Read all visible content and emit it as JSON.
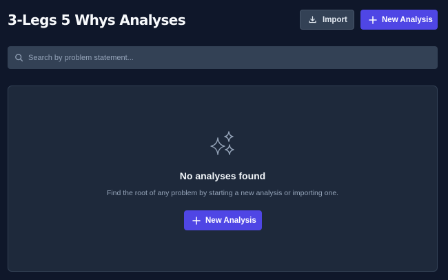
{
  "header": {
    "title": "3-Legs 5 Whys Analyses",
    "import_label": "Import",
    "new_analysis_label": "New Analysis"
  },
  "search": {
    "placeholder": "Search by problem statement...",
    "value": ""
  },
  "empty_state": {
    "icon": "sparkles-icon",
    "title": "No analyses found",
    "description": "Find the root of any problem by starting a new analysis or importing one.",
    "button_label": "New Analysis"
  },
  "colors": {
    "background": "#0f172a",
    "panel": "#1e293b",
    "input": "#334155",
    "accent": "#4f46e5",
    "muted_text": "#94a3b8"
  }
}
